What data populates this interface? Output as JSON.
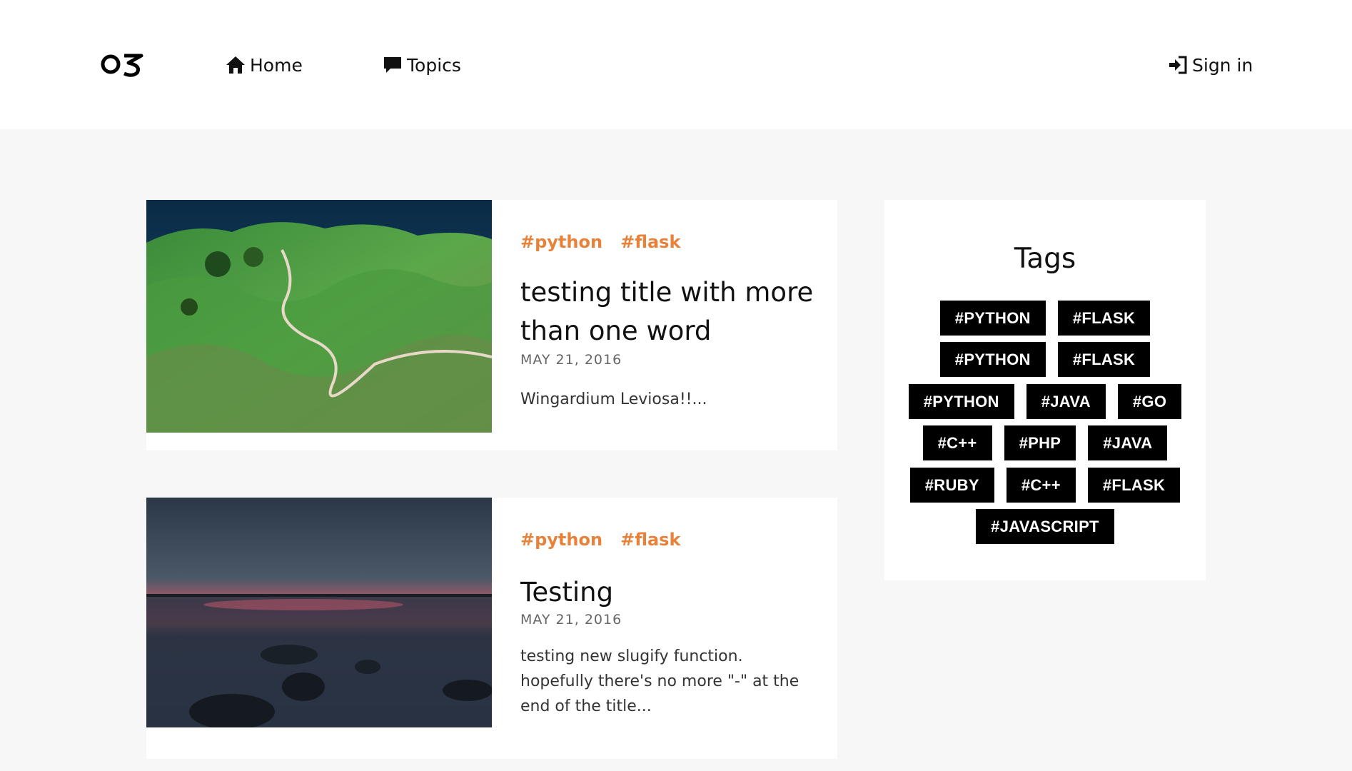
{
  "header": {
    "logo": "OS",
    "nav": [
      {
        "label": "Home",
        "icon": "home-icon"
      },
      {
        "label": "Topics",
        "icon": "chat-bubble-icon"
      }
    ],
    "sign_in": {
      "label": "Sign in",
      "icon": "sign-in-icon"
    }
  },
  "posts": [
    {
      "tags": [
        "#python",
        "#flask"
      ],
      "title": "testing title with more than one word",
      "date": "MAY 21, 2016",
      "excerpt": "Wingardium Leviosa!!...",
      "image": "aerial-green-hills-coastline-road"
    },
    {
      "tags": [
        "#python",
        "#flask"
      ],
      "title": "Testing",
      "date": "MAY 21, 2016",
      "excerpt": "testing new slugify function. hopefully there's no more \"-\" at the end of the title...",
      "image": "lake-sunset-rocks"
    }
  ],
  "sidebar": {
    "title": "Tags",
    "rows": [
      [
        "#PYTHON",
        "#FLASK"
      ],
      [
        "#PYTHON",
        "#FLASK"
      ],
      [
        "#PYTHON",
        "#JAVA",
        "#GO"
      ],
      [
        "#C++",
        "#PHP",
        "#JAVA"
      ],
      [
        "#RUBY",
        "#C++",
        "#FLASK"
      ],
      [
        "#JAVASCRIPT"
      ]
    ]
  },
  "colors": {
    "accent_tag": "#e8823a",
    "page_bg": "#f7f7f7",
    "chip_bg": "#000000"
  }
}
